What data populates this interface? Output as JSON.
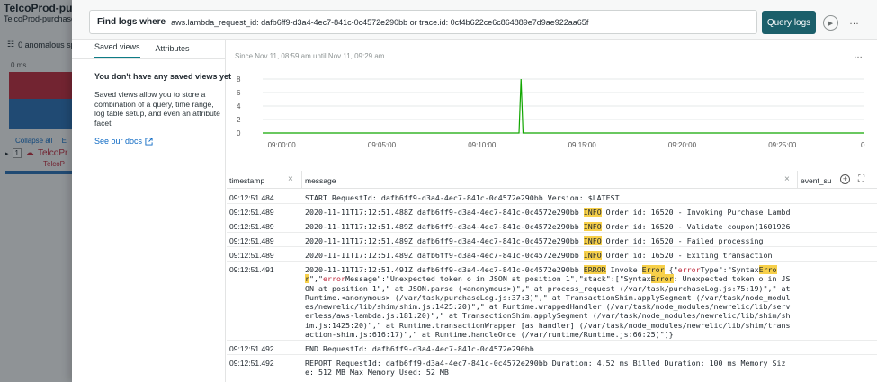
{
  "background": {
    "title": "TelcoProd-purcha",
    "subtitle": "TelcoProd-purchase-",
    "anomalous": "0 anomalous sp",
    "ms_label": "0 ms",
    "collapse_all": "Collapse all",
    "expand_text": "E",
    "row_count": "1",
    "row_name": "TelcoPr",
    "row_sub": "TelcoP"
  },
  "query": {
    "label": "Find logs where",
    "value": "aws.lambda_request_id: dafb6ff9-d3a4-4ec7-841c-0c4572e290bb or trace.id: 0cf4b622ce6c864889e7d9ae922aa65f",
    "button": "Query logs",
    "more": "…"
  },
  "sidebar": {
    "tabs": [
      "Saved views",
      "Attributes"
    ],
    "empty_title": "You don't have any saved views yet",
    "empty_desc": "Saved views allow you to store a combination of a query, time range, log table setup, and even an attribute facet.",
    "docs_link": "See our docs"
  },
  "chart": {
    "range": "Since Nov 11, 08:59 am until Nov 11, 09:29 am",
    "more": "…"
  },
  "chart_data": {
    "type": "line",
    "x": [
      "09:00:00",
      "09:05:00",
      "09:10:00",
      "09:15:00",
      "09:20:00",
      "09:25:00"
    ],
    "y_ticks": [
      0,
      2,
      4,
      6,
      8
    ],
    "ylim": [
      0,
      8
    ],
    "end_label": "0",
    "points": [
      [
        0,
        0
      ],
      [
        12.8,
        0
      ],
      [
        12.9,
        8
      ],
      [
        13.0,
        0
      ],
      [
        30,
        0
      ]
    ],
    "color": "#11a600",
    "xlabel": "",
    "ylabel": "",
    "title": ""
  },
  "table": {
    "columns": [
      "timestamp",
      "message",
      "event_su"
    ],
    "rows": [
      {
        "ts": "09:12:51.484",
        "msg": "START RequestId: dafb6ff9-d3a4-4ec7-841c-0c4572e290bb Version: $LATEST"
      },
      {
        "ts": "09:12:51.489",
        "msg": "2020-11-11T17:12:51.488Z dafb6ff9-d3a4-4ec7-841c-0c4572e290bb INFO Order id: 16520 - Invoking Purchase Lambda"
      },
      {
        "ts": "09:12:51.489",
        "msg": "2020-11-11T17:12:51.489Z dafb6ff9-d3a4-4ec7-841c-0c4572e290bb INFO Order id: 16520 - Validate coupon(1601926285)"
      },
      {
        "ts": "09:12:51.489",
        "msg": "2020-11-11T17:12:51.489Z dafb6ff9-d3a4-4ec7-841c-0c4572e290bb INFO Order id: 16520 - Failed processing"
      },
      {
        "ts": "09:12:51.489",
        "msg": "2020-11-11T17:12:51.489Z dafb6ff9-d3a4-4ec7-841c-0c4572e290bb INFO Order id: 16520 - Exiting transaction"
      },
      {
        "ts": "09:12:51.491",
        "msg": "2020-11-11T17:12:51.491Z dafb6ff9-d3a4-4ec7-841c-0c4572e290bb ERROR Invoke Error {\"errorType\":\"SyntaxError\",\"errorMessage\":\"Unexpected token o in JSON at position 1\",\"stack\":[\"SyntaxError: Unexpected token o in JSON at position 1\",\" at JSON.parse (<anonymous>)\",\" at process_request (/var/task/purchaseLog.js:75:19)\",\" at Runtime.<anonymous> (/var/task/purchaseLog.js:37:3)\",\" at TransactionShim.applySegment (/var/task/node_modules/newrelic/lib/shim/shim.js:1425:20)\",\" at Runtime.wrappedHandler (/var/task/node_modules/newrelic/lib/serverless/aws-lambda.js:181:20)\",\" at TransactionShim.applySegment (/var/task/node_modules/newrelic/lib/shim/shim.js:1425:20)\",\" at Runtime.transactionWrapper [as handler] (/var/task/node_modules/newrelic/lib/shim/transaction-shim.js:616:17)\",\" at Runtime.handleOnce (/var/runtime/Runtime.js:66:25)\"]}"
      },
      {
        "ts": "09:12:51.492",
        "msg": "END RequestId: dafb6ff9-d3a4-4ec7-841c-0c4572e290bb"
      },
      {
        "ts": "09:12:51.492",
        "msg": "REPORT RequestId: dafb6ff9-d3a4-4ec7-841c-0c4572e290bb Duration: 4.52 ms Billed Duration: 100 ms Memory Size: 512 MB Max Memory Used: 52 MB"
      }
    ]
  },
  "colors": {
    "accent": "#1b5f6a",
    "link": "#0e6ac4",
    "highlight": "#f7d04a",
    "error_text": "#bf2a3d"
  }
}
